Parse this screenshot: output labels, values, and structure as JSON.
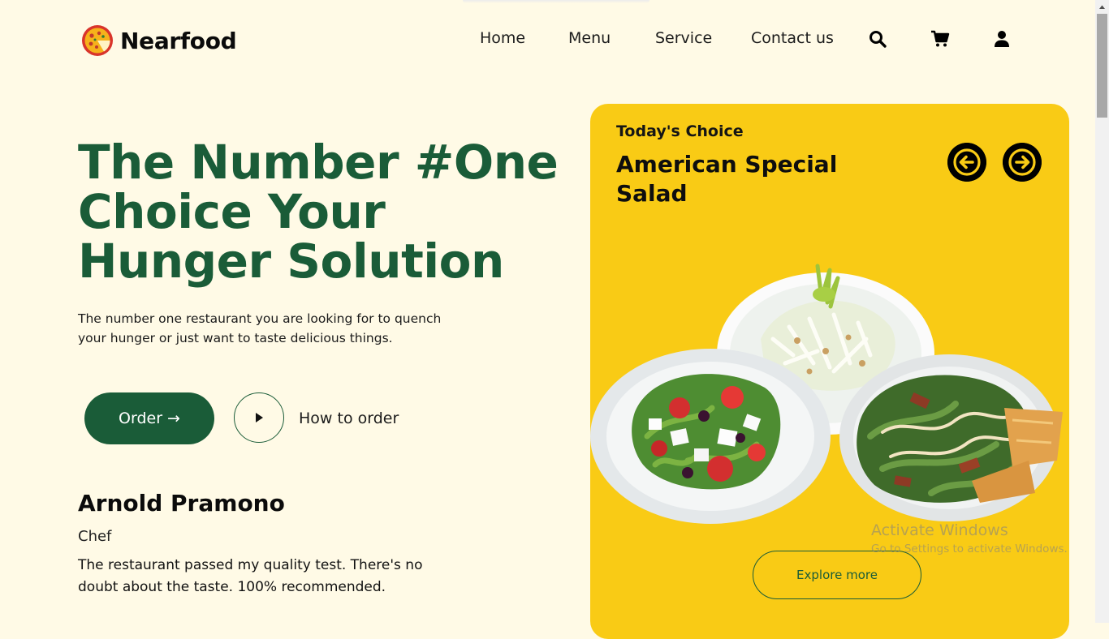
{
  "brand": {
    "name": "Nearfood"
  },
  "nav": {
    "items": [
      {
        "label": "Home"
      },
      {
        "label": "Menu"
      },
      {
        "label": "Service"
      },
      {
        "label": "Contact us"
      }
    ],
    "icons": [
      "search-icon",
      "cart-icon",
      "user-icon"
    ]
  },
  "hero": {
    "title": "The Number #One Choice Your Hunger Solution",
    "description": "The number one restaurant you are looking for to quench your hunger or just want to taste delicious things.",
    "order_label": "Order →",
    "how_to_label": "How to order"
  },
  "review": {
    "name": "Arnold Pramono",
    "role": "Chef",
    "quote": "The restaurant passed my quality test. There's no doubt about the taste. 100% recommended."
  },
  "feature": {
    "kicker": "Today's Choice",
    "title": "American Special Salad",
    "explore_label": "Explore more"
  },
  "os_watermark": {
    "title": "Activate Windows",
    "subtitle": "Go to Settings to activate Windows."
  },
  "colors": {
    "background": "#fffae6",
    "brand_green": "#1a5c38",
    "card_yellow": "#f9cb15"
  }
}
